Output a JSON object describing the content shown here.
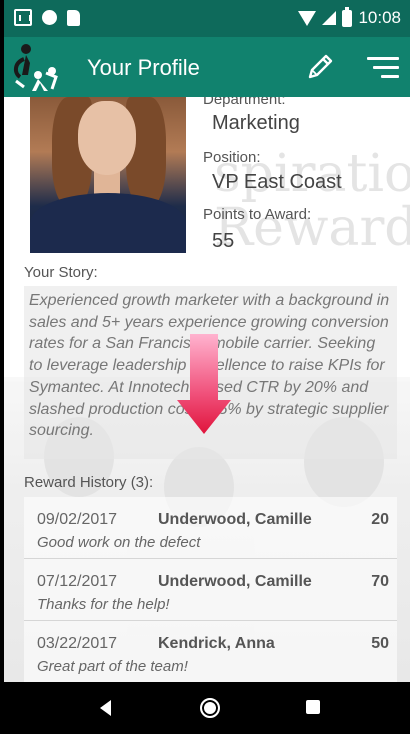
{
  "status_bar": {
    "time": "10:08"
  },
  "app_bar": {
    "title": "Your Profile"
  },
  "profile": {
    "department_label": "Department:",
    "department": "Marketing",
    "position_label": "Position:",
    "position": "VP East Coast",
    "points_label": "Points to Award:",
    "points": "55",
    "story_label": "Your Story:",
    "story": "Experienced growth marketer with a background in sales and 5+ years experience growing conversion rates for a San Francisco mobile carrier. Seeking to leverage leadership excellence to raise KPIs for Symantec. At Innotech, raised CTR by 20% and slashed production costs 15% by strategic supplier sourcing."
  },
  "background_watermark": {
    "line1": "spiration",
    "line2": "Rewards"
  },
  "reward_history": {
    "label": "Reward History (3):",
    "rows": [
      {
        "date": "09/02/2017",
        "name": "Underwood, Camille",
        "points": "20",
        "note": "Good work on the defect"
      },
      {
        "date": "07/12/2017",
        "name": "Underwood, Camille",
        "points": "70",
        "note": "Thanks for the help!"
      },
      {
        "date": "03/22/2017",
        "name": "Kendrick, Anna",
        "points": "50",
        "note": "Great part of the team!"
      }
    ]
  },
  "colors": {
    "status_bar": "#0e6a5b",
    "app_bar": "#11826e",
    "arrow_top": "#ff9fc0",
    "arrow_bottom": "#e0143c"
  },
  "icons": [
    "gallery-icon",
    "circle-icon",
    "sd-card-icon",
    "wifi-icon",
    "signal-icon",
    "battery-icon",
    "app-logo-icon",
    "pencil-icon",
    "menu-icon",
    "scroll-arrow-icon",
    "back-icon",
    "home-icon",
    "recent-apps-icon"
  ]
}
